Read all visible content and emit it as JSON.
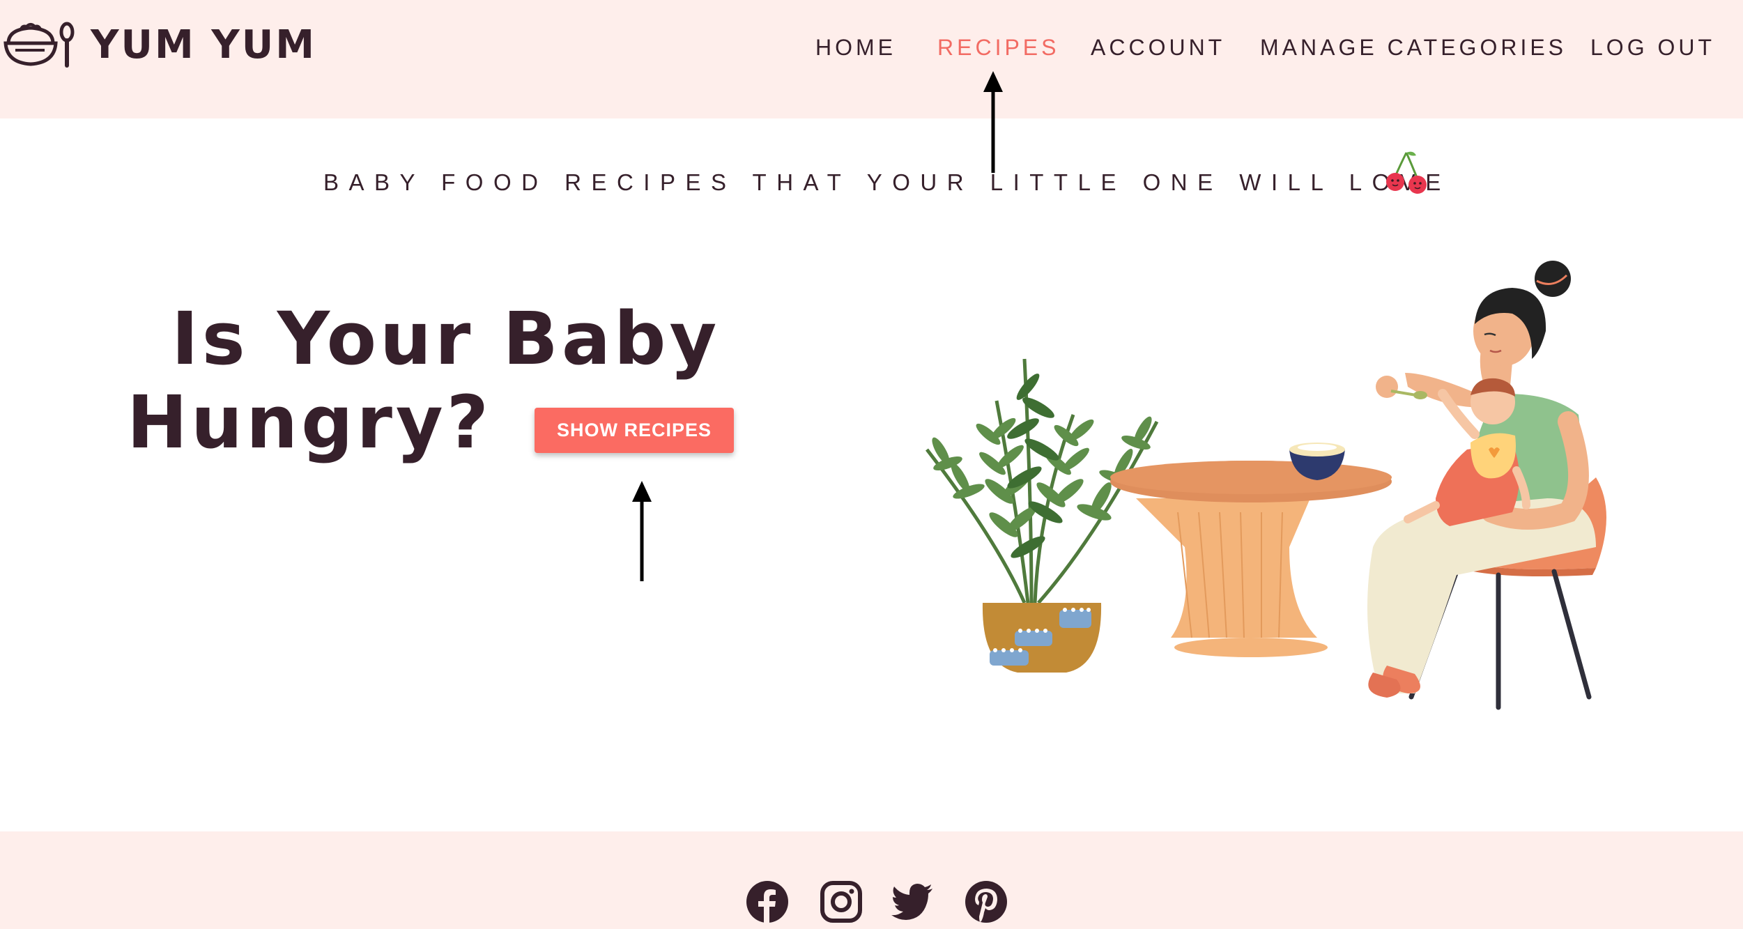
{
  "brand": {
    "name": "YUM YUM"
  },
  "nav": {
    "items": [
      {
        "label": "HOME",
        "active": false
      },
      {
        "label": "RECIPES",
        "active": true
      },
      {
        "label": "ACCOUNT",
        "active": false
      },
      {
        "label": "MANAGE CATEGORIES",
        "active": false
      },
      {
        "label": "LOG OUT",
        "active": false
      }
    ]
  },
  "tagline": {
    "text": "BABY FOOD RECIPES THAT YOUR LITTLE ONE WILL LOVE",
    "icon": "cherry-icon"
  },
  "hero": {
    "line1": "Is Your Baby",
    "line2": "Hungry?",
    "cta_label": "SHOW RECIPES"
  },
  "footer": {
    "social": [
      "facebook-icon",
      "instagram-icon",
      "twitter-icon",
      "pinterest-icon"
    ]
  },
  "colors": {
    "header_bg": "#feeeeb",
    "text_dark": "#36202b",
    "accent": "#f26b63",
    "button": "#fb6b62"
  }
}
